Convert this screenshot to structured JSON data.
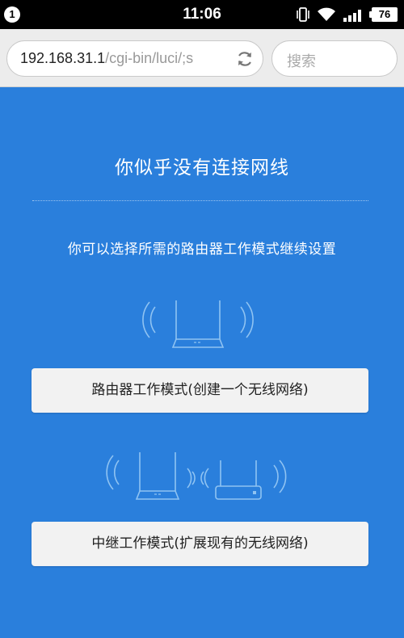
{
  "status_bar": {
    "notification_count": "1",
    "time": "11:06",
    "battery": "76",
    "icons": [
      "vibrate-icon",
      "wifi-icon",
      "signal-icon",
      "battery-icon"
    ]
  },
  "browser": {
    "url_host": "192.168.31.1",
    "url_path": "/cgi-bin/luci/;s",
    "search_placeholder": "搜索",
    "reload_icon": "reload-icon"
  },
  "page": {
    "title": "你似乎没有连接网线",
    "subtitle": "你可以选择所需的路由器工作模式继续设置",
    "router_mode_button": "路由器工作模式(创建一个无线网络)",
    "repeater_mode_button": "中继工作模式(扩展现有的无线网络)"
  },
  "colors": {
    "background": "#2a7fdc",
    "button": "#f2f2f2",
    "illustration_line": "#8fc3f2"
  }
}
